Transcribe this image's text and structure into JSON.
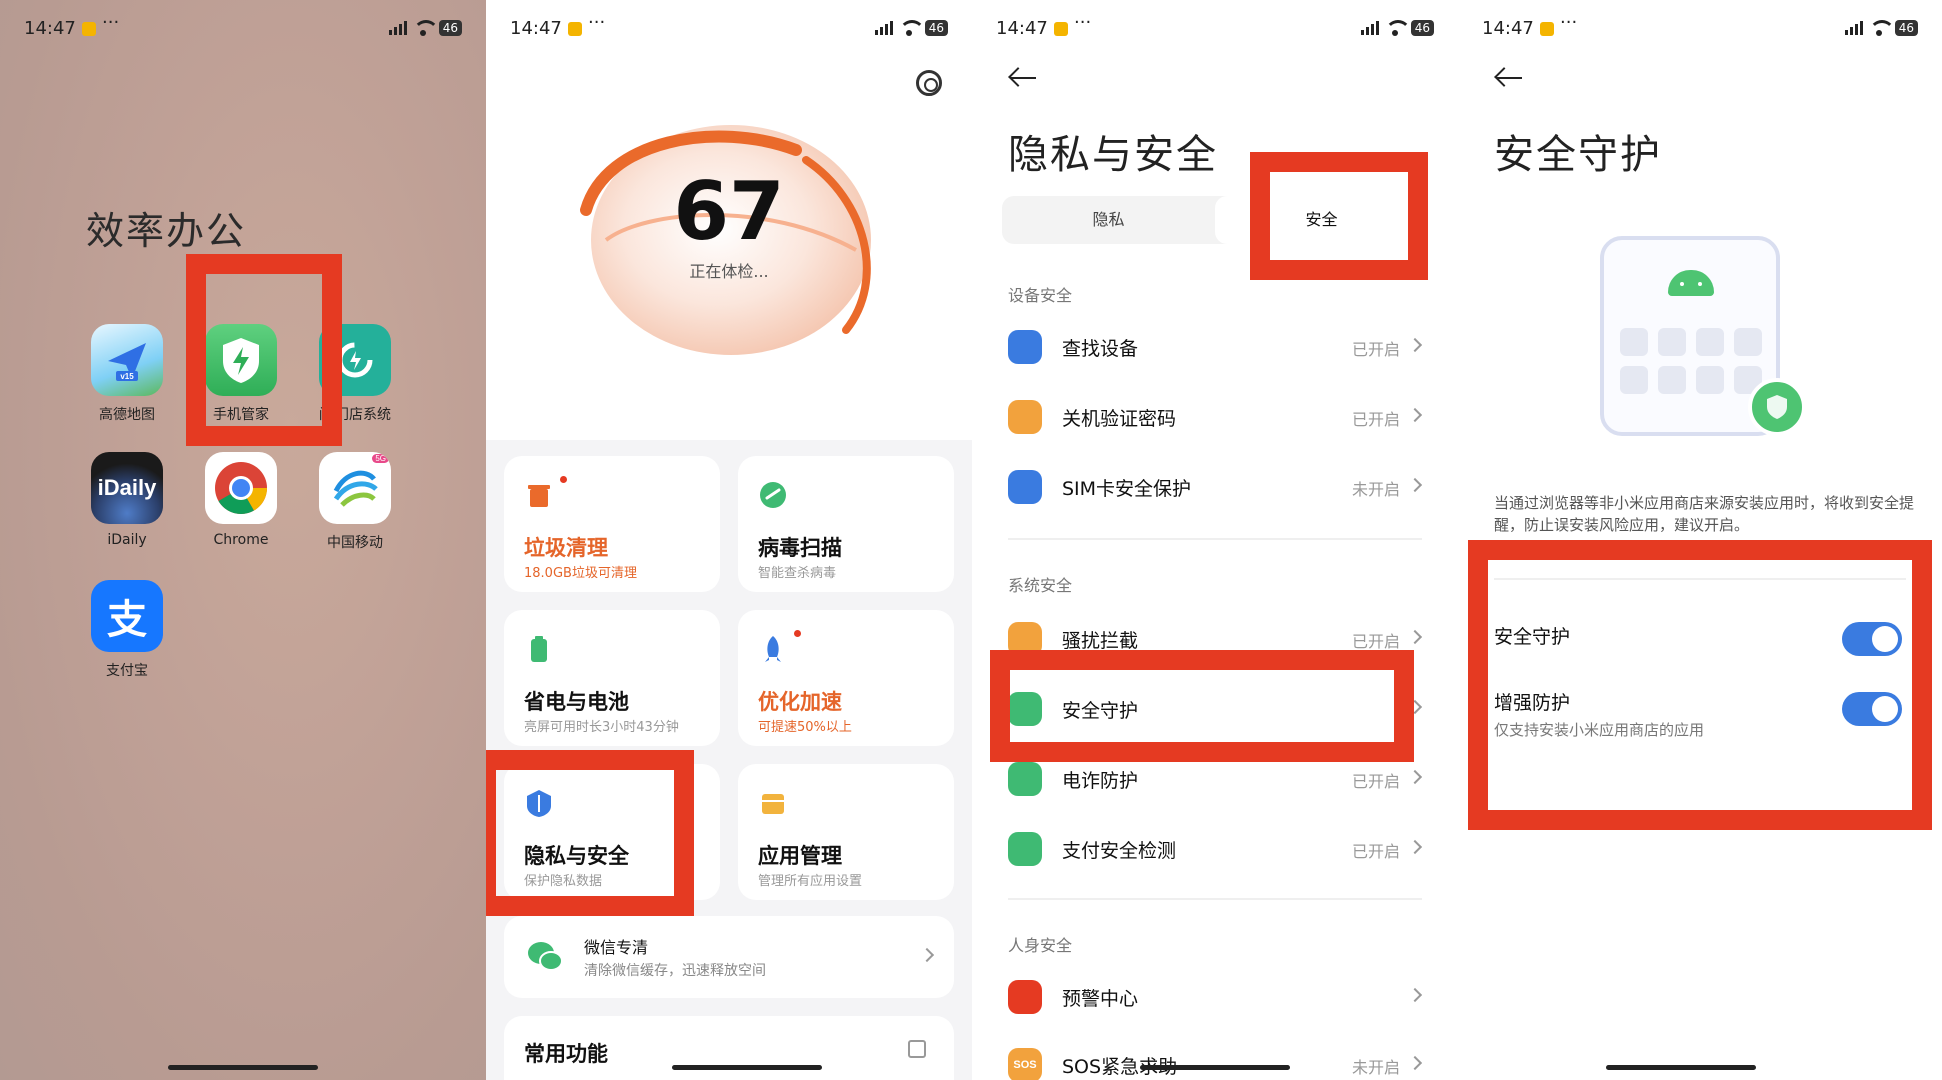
{
  "status": {
    "time": "14:47",
    "more": "···",
    "battery": "46"
  },
  "panel1": {
    "folder_title": "效率办公",
    "apps": [
      {
        "label": "高德地图",
        "icon": "navigation-arrow-icon",
        "badge": "v15"
      },
      {
        "label": "手机管家",
        "icon": "shield-bolt-icon"
      },
      {
        "label": "门店系统",
        "icon": "refresh-cycle-icon",
        "prefix": "闪"
      },
      {
        "label": "iDaily",
        "icon": "idaily-globe-icon",
        "text": "iDaily"
      },
      {
        "label": "Chrome",
        "icon": "chrome-icon"
      },
      {
        "label": "中国移动",
        "icon": "china-mobile-icon",
        "badge": "5G"
      },
      {
        "label": "支付宝",
        "icon": "alipay-icon",
        "text": "支"
      }
    ]
  },
  "panel2": {
    "score": "67",
    "checking": "正在体检...",
    "cards": [
      {
        "title": "垃圾清理",
        "sub": "18.0GB垃圾可清理"
      },
      {
        "title": "病毒扫描",
        "sub": "智能查杀病毒"
      },
      {
        "title": "省电与电池",
        "sub": "亮屏可用时长3小时43分钟"
      },
      {
        "title": "优化加速",
        "sub": "可提速50%以上"
      },
      {
        "title": "隐私与安全",
        "sub": "保护隐私数据"
      },
      {
        "title": "应用管理",
        "sub": "管理所有应用设置"
      }
    ],
    "wechat": {
      "title": "微信专清",
      "sub": "清除微信缓存，迅速释放空间"
    },
    "common": "常用功能"
  },
  "panel3": {
    "title": "隐私与安全",
    "tabs": [
      "隐私",
      "安全"
    ],
    "sections": [
      "设备安全",
      "系统安全",
      "人身安全"
    ],
    "rows": [
      {
        "label": "查找设备",
        "value": "已开启"
      },
      {
        "label": "关机验证密码",
        "value": "已开启"
      },
      {
        "label": "SIM卡安全保护",
        "value": "未开启"
      },
      {
        "label": "骚扰拦截",
        "value": "已开启"
      },
      {
        "label": "安全守护",
        "value": ""
      },
      {
        "label": "电诈防护",
        "value": "已开启"
      },
      {
        "label": "支付安全检测",
        "value": "已开启"
      },
      {
        "label": "预警中心",
        "value": ""
      },
      {
        "label": "SOS紧急求助",
        "value": "未开启",
        "icon_text": "SOS"
      }
    ]
  },
  "panel4": {
    "title": "安全守护",
    "description": "当通过浏览器等非小米应用商店来源安装应用时，将收到安全提醒，防止误安装风险应用，建议开启。",
    "toggles": [
      {
        "label": "安全守护",
        "sub": "",
        "on": true
      },
      {
        "label": "增强防护",
        "sub": "仅支持安装小米应用商店的应用",
        "on": true
      }
    ]
  },
  "colors": {
    "highlight": "#e53a22",
    "accent_orange": "#e5652a",
    "toggle_on": "#3a7be0",
    "green": "#4ec472"
  }
}
